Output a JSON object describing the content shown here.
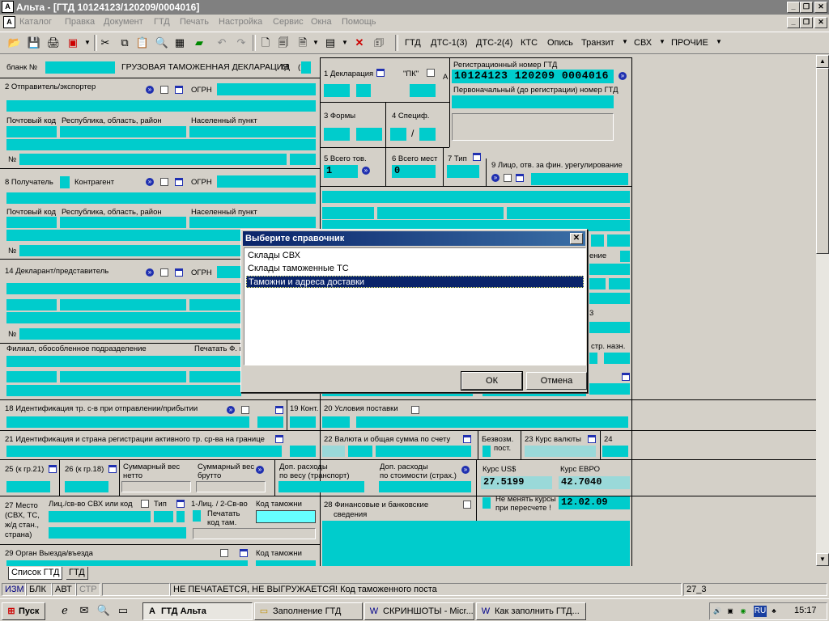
{
  "window": {
    "title": "Альта - [ГТД 10124123/120209/0004016]",
    "app_icon": "A"
  },
  "menu": [
    "Каталог",
    "Правка",
    "Документ",
    "ГТД",
    "Печать",
    "Настройка",
    "Сервис",
    "Окна",
    "Помощь"
  ],
  "toolbar": {
    "icons": [
      "open-folder-icon",
      "save-icon",
      "print-icon",
      "print-preview-icon",
      "cut-icon",
      "copy-icon",
      "paste-icon",
      "find-icon",
      "grid-icon",
      "book-icon",
      "undo-icon",
      "redo-icon",
      "new-doc-icon",
      "docs-icon",
      "doc-dropdown-icon",
      "table-icon",
      "delete-icon",
      "clipboard-icon"
    ],
    "text_buttons": [
      "ГТД",
      "ДТС-1(3)",
      "ДТС-2(4)",
      "КТС",
      "Опись",
      "Транзит",
      "СВХ",
      "ПРОЧИЕ"
    ]
  },
  "form": {
    "blank_label": "бланк №",
    "form_title": "ГРУЗОВАЯ ТАМОЖЕННАЯ ДЕКЛАРАЦИЯ",
    "td_label": "ТД",
    "box2_label": "2 Отправитель/экспортер",
    "ogrn": "ОГРН",
    "postal_code": "Почтовый код",
    "region": "Республика, область, район",
    "settlement": "Населенный пункт",
    "number_sign": "№",
    "box8_label": "8 Получатель",
    "counterparty": "Контрагент",
    "box14_label": "14 Декларант/представитель",
    "branch": "Филиал, обособленное подразделение",
    "print_f": "Печатать Ф. к",
    "box1_label": "1 Декларация",
    "pk_label": "\"ПК\"",
    "box3_label": "3 Формы",
    "box4_label": "4 Специф.",
    "slash": "/",
    "box5_label": "5 Всего тов.",
    "box5_value": "1",
    "box6_label": "6 Всего мест",
    "box6_value": "0",
    "box7_label": "7 Тип",
    "box9_label": "9 Лицо, отв. за фин. урегулирование",
    "a_label": "А",
    "reg_number_label": "Регистрационный номер ГТД",
    "reg_number": "10124123 120209 0004016",
    "initial_number_label": "Первоначальный (до регистрации) номер ГТД",
    "partial_1": "ение",
    "partial_2": "3",
    "partial_3": "стр. назн.",
    "box18_label": "18 Идентификация тр. с-в при отправлении/прибытии",
    "box19_label": "19 Конт.",
    "box20_label": "20 Условия поставки",
    "box21_label": "21 Идентификация и страна регистрации активного тр. ср-ва на границе",
    "box22_label": "22 Валюта и общая сумма по счету",
    "free_label_1": "Безвозм.",
    "free_label_2": "пост.",
    "box23_label": "23 Курс валюты",
    "box24_label": "24",
    "box25_label": "25 (к гр.21)",
    "box26_label": "26 (к гр.18)",
    "total_net_1": "Суммарный вес",
    "total_net_2": "нетто",
    "total_gross_1": "Суммарный вес",
    "total_gross_2": "брутто",
    "extra_weight_1": "Доп. расходы",
    "extra_weight_2": "по весу (транспорт)",
    "extra_cost_1": "Доп. расходы",
    "extra_cost_2": "по стоимости (страх.)",
    "usd_label": "Курс US$",
    "usd_value": "27.5199",
    "eur_label": "Курс ЕВРО",
    "eur_value": "42.7040",
    "no_change_1": "Не менять курсы",
    "no_change_2": "при пересчете !",
    "rate_date": "12.02.09",
    "box27_label_1": "27 Место",
    "box27_label_2": "(СВХ, ТС,",
    "box27_label_3": "ж/д стан.,",
    "box27_label_4": "страна)",
    "svh_person": "Лиц./св-во СВХ или код",
    "type_label": "Тип",
    "one_person": "1-Лиц. / 2-Св-во",
    "print_code_1": "Печатать",
    "print_code_2": "код там.",
    "customs_code": "Код таможни",
    "box28_label_1": "28 Финансовые и банковские",
    "box28_label_2": "сведения",
    "box29_label": "29 Орган Выезда/въезда",
    "customs_code_2": "Код таможни"
  },
  "dialog": {
    "title": "Выберите справочник",
    "items": [
      "Склады СВХ",
      "Склады таможенные ТС",
      "Таможни и адреса доставки"
    ],
    "selected_index": 2,
    "ok": "ОК",
    "cancel": "Отмена"
  },
  "tabs": [
    "Список ГТД",
    "ГТД"
  ],
  "status": {
    "izm": "ИЗМ",
    "blk": "БЛК",
    "avt": "АВТ",
    "str": "СТР",
    "message": "НЕ ПЕЧАТАЕТСЯ, НЕ ВЫГРУЖАЕТСЯ! Код таможенного поста",
    "cell": "27_3"
  },
  "taskbar": {
    "start": "Пуск",
    "buttons": [
      "ГТД Альта",
      "Заполнение ГТД",
      "СКРИНШОТЫ - Micr...",
      "Как заполнить ГТД..."
    ],
    "lang": "RU",
    "clock": "15:17"
  },
  "colors": {
    "field": "#00cccc",
    "selection": "#0a246a",
    "titlebar_inactive": "#808080"
  }
}
